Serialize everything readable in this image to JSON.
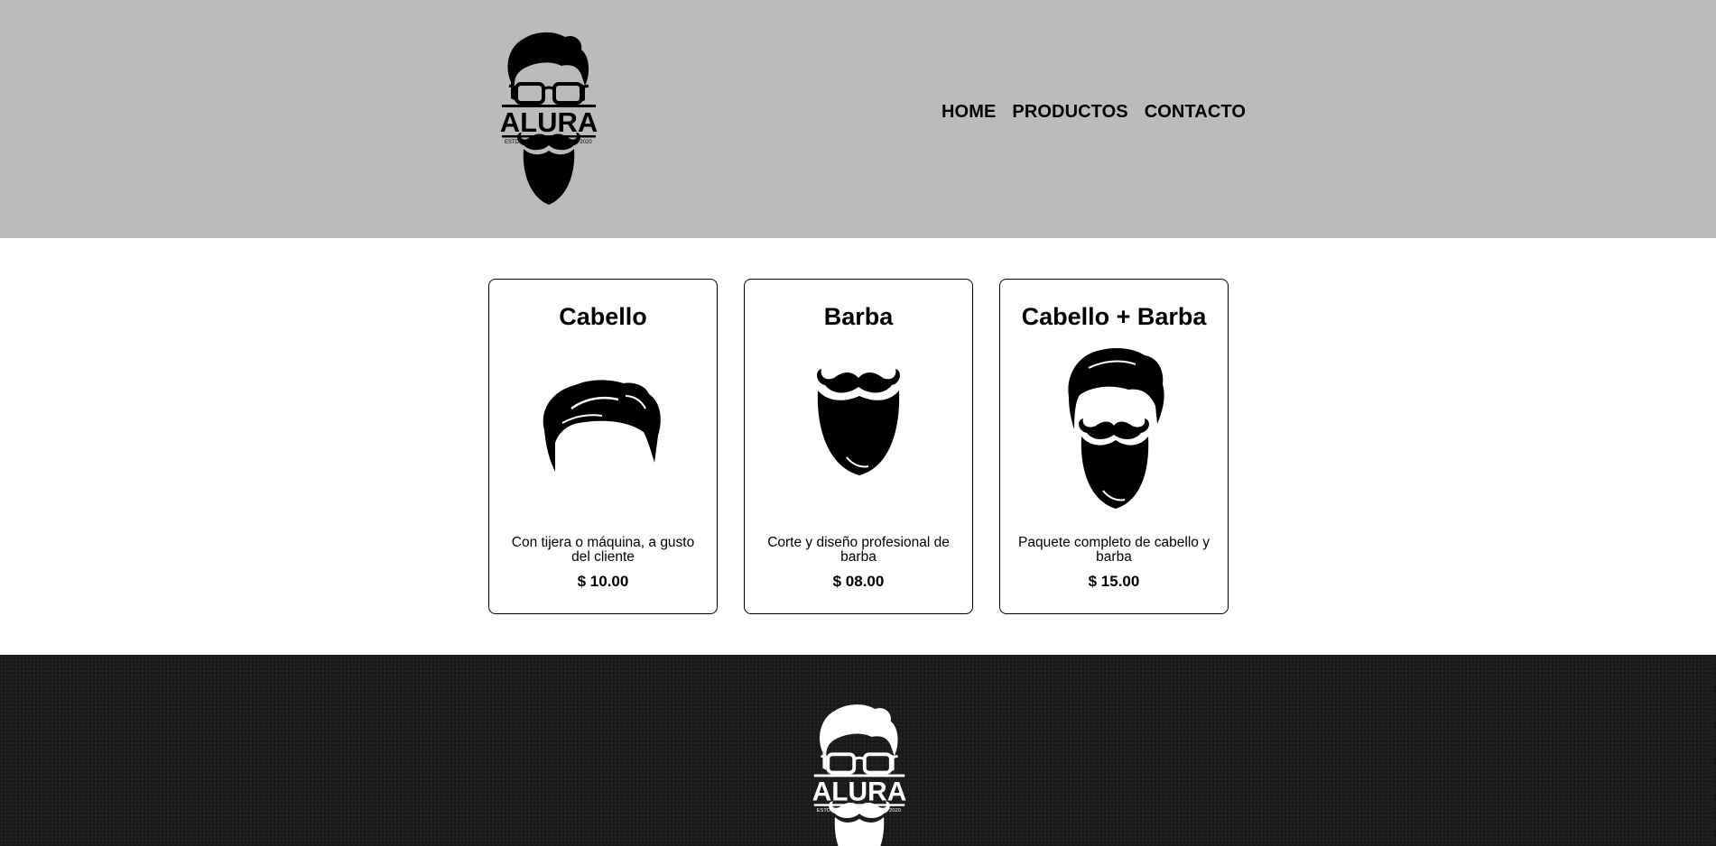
{
  "header": {
    "logo": {
      "name": "ALURA",
      "left_tag": "ESTD",
      "right_tag": "2020"
    },
    "nav": [
      {
        "label": "HOME"
      },
      {
        "label": "PRODUCTOS"
      },
      {
        "label": "CONTACTO"
      }
    ]
  },
  "products": [
    {
      "title": "Cabello",
      "icon": "hair-icon",
      "description": "Con tijera o máquina, a gusto del cliente",
      "price": "$ 10.00"
    },
    {
      "title": "Barba",
      "icon": "beard-icon",
      "description": "Corte y diseño profesional de barba",
      "price": "$ 08.00"
    },
    {
      "title": "Cabello + Barba",
      "icon": "hair-and-beard-icon",
      "description": "Paquete completo de cabello y barba",
      "price": "$ 15.00"
    }
  ],
  "footer": {
    "logo": {
      "name": "ALURA",
      "left_tag": "ESTD",
      "right_tag": "2020"
    }
  },
  "colors": {
    "header_bg": "#bbbbbb",
    "footer_bg": "#1b1b1b",
    "text": "#000000"
  }
}
